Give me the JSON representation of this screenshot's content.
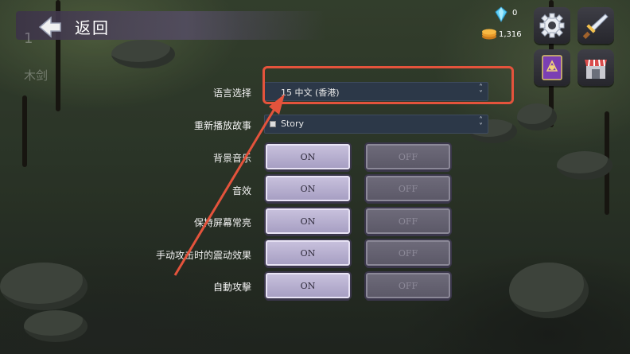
{
  "header": {
    "back_label": "返回",
    "bg_text_1": "1",
    "bg_text_2": "木剑"
  },
  "currency": {
    "gems": "0",
    "coins": "1,316"
  },
  "settings": {
    "language": {
      "label": "语言选择",
      "value": "15 中文 (香港)"
    },
    "replay_story": {
      "label": "重新播放故事",
      "value": "Story"
    },
    "rows": [
      {
        "label": "背景音乐",
        "on": "ON",
        "off": "OFF"
      },
      {
        "label": "音效",
        "on": "ON",
        "off": "OFF"
      },
      {
        "label": "保持屏幕常亮",
        "on": "ON",
        "off": "OFF"
      },
      {
        "label": "手动攻击时的震动效果",
        "on": "ON",
        "off": "OFF"
      },
      {
        "label": "自動攻擊",
        "on": "ON",
        "off": "OFF"
      }
    ]
  },
  "annotation": {
    "color": "#e4533c"
  },
  "icons": [
    "back-arrow-icon",
    "gem-icon",
    "coin-icon",
    "gear-icon",
    "sword-icon",
    "spellbook-icon",
    "shop-icon",
    "chevron-updown-icon"
  ]
}
